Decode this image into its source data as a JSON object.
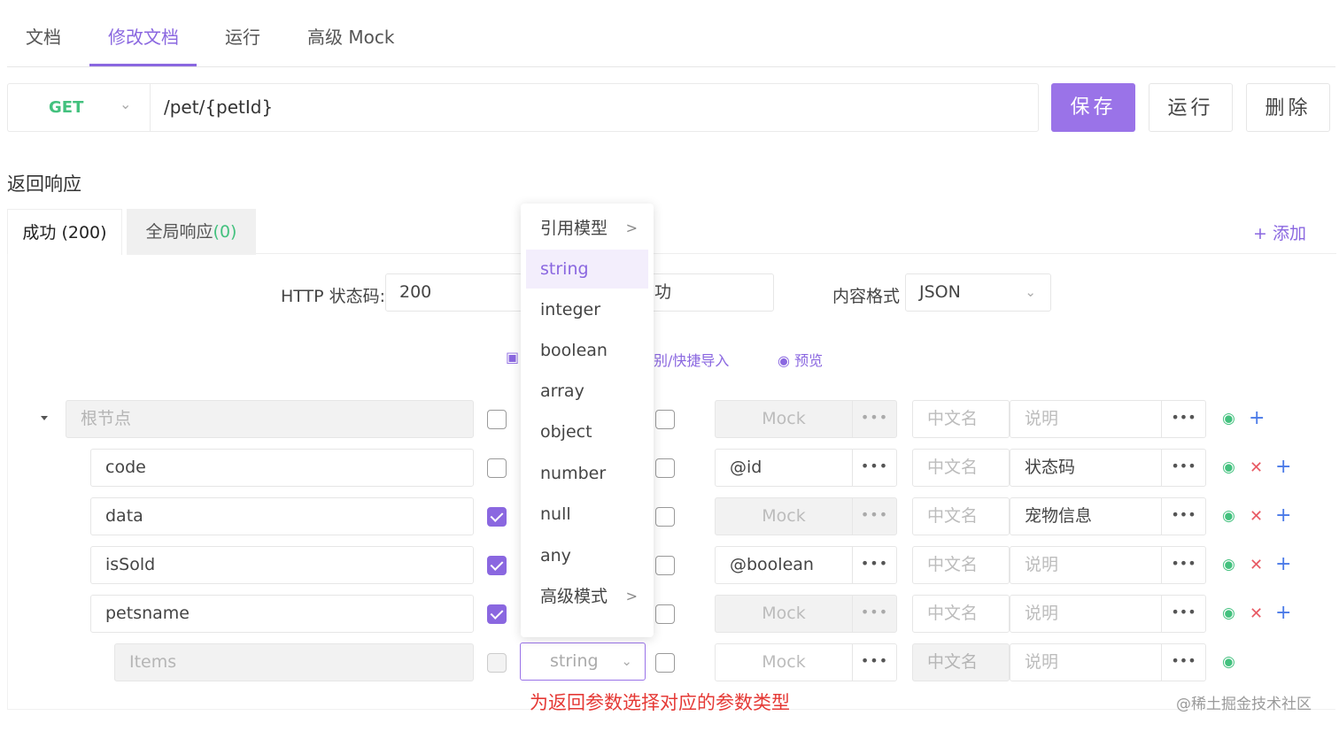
{
  "top_tabs": [
    "文档",
    "修改文档",
    "运行",
    "高级 Mock"
  ],
  "request": {
    "method": "GET",
    "url": "/pet/{petId}"
  },
  "actions": {
    "save": "保存",
    "run": "运行",
    "delete": "删除"
  },
  "section_title": "返回响应",
  "response_tabs": {
    "success": "成功 (200)",
    "global": "全局响应",
    "global_count": "(0)",
    "add": "+ 添加"
  },
  "form": {
    "status_label": "HTTP 状态码:",
    "status_value": "200",
    "name_value_tail": "功",
    "format_label": "内容格式",
    "format_value": "JSON",
    "import_link": "别/快捷导入",
    "preview_link": "预览"
  },
  "rows": [
    {
      "name": "根节点",
      "name_disabled": true,
      "required": false,
      "mock": "Mock",
      "mock_disabled": true,
      "cn": "中文名",
      "desc": "说明",
      "desc_placeholder": true
    },
    {
      "name": "code",
      "required": false,
      "mock": "@id",
      "cn": "中文名",
      "desc": "状态码"
    },
    {
      "name": "data",
      "required": true,
      "mock": "Mock",
      "mock_disabled": true,
      "cn": "中文名",
      "desc": "宠物信息"
    },
    {
      "name": "isSold",
      "required": true,
      "mock": "@boolean",
      "cn": "中文名",
      "desc": "说明",
      "desc_placeholder": true
    },
    {
      "name": "petsname",
      "required": true,
      "mock": "Mock",
      "mock_disabled": true,
      "cn": "中文名",
      "desc": "说明",
      "desc_placeholder": true
    },
    {
      "name": "Items",
      "name_disabled": true,
      "required": false,
      "type": "string",
      "mock": "Mock",
      "cn": "中文名",
      "desc": "说明",
      "desc_placeholder": true
    }
  ],
  "dropdown": {
    "items": [
      "引用模型",
      "string",
      "integer",
      "boolean",
      "array",
      "object",
      "number",
      "null",
      "any",
      "高级模式"
    ],
    "selected": "string"
  },
  "note": "为返回参数选择对应的参数类型",
  "watermark": "@稀土掘金技术社区",
  "colors": {
    "accent": "#8a67e0",
    "green": "#43c17e",
    "red": "#e53935"
  }
}
